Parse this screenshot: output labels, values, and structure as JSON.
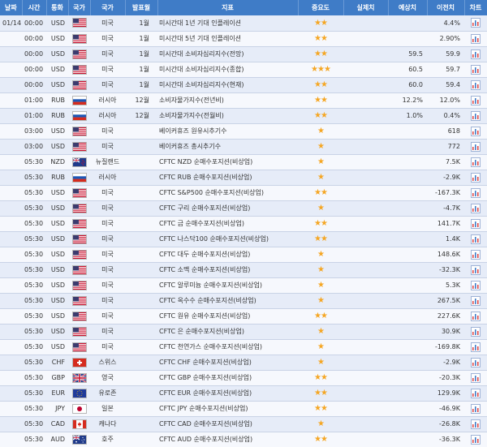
{
  "headers": [
    "날짜",
    "시간",
    "통화",
    "국가",
    "국가",
    "발표월",
    "지표",
    "중요도",
    "실제치",
    "예상치",
    "이전치",
    "차트"
  ],
  "rows": [
    {
      "date": "01/14",
      "time": "00:00",
      "cur": "USD",
      "flag": "us",
      "country": "미국",
      "period": "1월",
      "name": "미시간대 1년 기대 인플레이션",
      "stars": 2,
      "actual": "",
      "forecast": "",
      "previous": "4.4%"
    },
    {
      "date": "",
      "time": "00:00",
      "cur": "USD",
      "flag": "us",
      "country": "미국",
      "period": "1월",
      "name": "미시간대 5년 기대 인플레이션",
      "stars": 2,
      "actual": "",
      "forecast": "",
      "previous": "2.90%"
    },
    {
      "date": "",
      "time": "00:00",
      "cur": "USD",
      "flag": "us",
      "country": "미국",
      "period": "1월",
      "name": "미시간대 소비자심리지수(전망)",
      "stars": 2,
      "actual": "",
      "forecast": "59.5",
      "previous": "59.9"
    },
    {
      "date": "",
      "time": "00:00",
      "cur": "USD",
      "flag": "us",
      "country": "미국",
      "period": "1월",
      "name": "미시간대 소비자심리지수(종합)",
      "stars": 3,
      "actual": "",
      "forecast": "60.5",
      "previous": "59.7"
    },
    {
      "date": "",
      "time": "00:00",
      "cur": "USD",
      "flag": "us",
      "country": "미국",
      "period": "1월",
      "name": "미시간대 소비자심리지수(현재)",
      "stars": 2,
      "actual": "",
      "forecast": "60.0",
      "previous": "59.4"
    },
    {
      "date": "",
      "time": "01:00",
      "cur": "RUB",
      "flag": "ru",
      "country": "러시아",
      "period": "12월",
      "name": "소비자물가지수(전년비)",
      "stars": 2,
      "actual": "",
      "forecast": "12.2%",
      "previous": "12.0%"
    },
    {
      "date": "",
      "time": "01:00",
      "cur": "RUB",
      "flag": "ru",
      "country": "러시아",
      "period": "12월",
      "name": "소비자물가지수(전월비)",
      "stars": 2,
      "actual": "",
      "forecast": "1.0%",
      "previous": "0.4%"
    },
    {
      "date": "",
      "time": "03:00",
      "cur": "USD",
      "flag": "us",
      "country": "미국",
      "period": "",
      "name": "베이커휴즈 원유시추기수",
      "stars": 1,
      "actual": "",
      "forecast": "",
      "previous": "618"
    },
    {
      "date": "",
      "time": "03:00",
      "cur": "USD",
      "flag": "us",
      "country": "미국",
      "period": "",
      "name": "베이커휴즈 총시추기수",
      "stars": 1,
      "actual": "",
      "forecast": "",
      "previous": "772"
    },
    {
      "date": "",
      "time": "05:30",
      "cur": "NZD",
      "flag": "nz",
      "country": "뉴질랜드",
      "period": "",
      "name": "CFTC NZD 순매수포지션(비상업)",
      "stars": 1,
      "actual": "",
      "forecast": "",
      "previous": "7.5K"
    },
    {
      "date": "",
      "time": "05:30",
      "cur": "RUB",
      "flag": "ru",
      "country": "러시아",
      "period": "",
      "name": "CFTC RUB 순매수포지션(비상업)",
      "stars": 1,
      "actual": "",
      "forecast": "",
      "previous": "-2.9K"
    },
    {
      "date": "",
      "time": "05:30",
      "cur": "USD",
      "flag": "us",
      "country": "미국",
      "period": "",
      "name": "CFTC S&P500 순매수포지션(비상업)",
      "stars": 2,
      "actual": "",
      "forecast": "",
      "previous": "-167.3K"
    },
    {
      "date": "",
      "time": "05:30",
      "cur": "USD",
      "flag": "us",
      "country": "미국",
      "period": "",
      "name": "CFTC 구리 순매수포지션(비상업)",
      "stars": 1,
      "actual": "",
      "forecast": "",
      "previous": "-4.7K"
    },
    {
      "date": "",
      "time": "05:30",
      "cur": "USD",
      "flag": "us",
      "country": "미국",
      "period": "",
      "name": "CFTC 금 순매수포지션(비상업)",
      "stars": 2,
      "actual": "",
      "forecast": "",
      "previous": "141.7K"
    },
    {
      "date": "",
      "time": "05:30",
      "cur": "USD",
      "flag": "us",
      "country": "미국",
      "period": "",
      "name": "CFTC 나스닥100 순매수포지션(비상업)",
      "stars": 2,
      "actual": "",
      "forecast": "",
      "previous": "1.4K"
    },
    {
      "date": "",
      "time": "05:30",
      "cur": "USD",
      "flag": "us",
      "country": "미국",
      "period": "",
      "name": "CFTC 대두 순매수포지션(비상업)",
      "stars": 1,
      "actual": "",
      "forecast": "",
      "previous": "148.6K"
    },
    {
      "date": "",
      "time": "05:30",
      "cur": "USD",
      "flag": "us",
      "country": "미국",
      "period": "",
      "name": "CFTC 소맥 순매수포지션(비상업)",
      "stars": 1,
      "actual": "",
      "forecast": "",
      "previous": "-32.3K"
    },
    {
      "date": "",
      "time": "05:30",
      "cur": "USD",
      "flag": "us",
      "country": "미국",
      "period": "",
      "name": "CFTC 알루미늄 순매수포지션(비상업)",
      "stars": 1,
      "actual": "",
      "forecast": "",
      "previous": "5.3K"
    },
    {
      "date": "",
      "time": "05:30",
      "cur": "USD",
      "flag": "us",
      "country": "미국",
      "period": "",
      "name": "CFTC 옥수수 순매수포지션(비상업)",
      "stars": 1,
      "actual": "",
      "forecast": "",
      "previous": "267.5K"
    },
    {
      "date": "",
      "time": "05:30",
      "cur": "USD",
      "flag": "us",
      "country": "미국",
      "period": "",
      "name": "CFTC 원유 순매수포지션(비상업)",
      "stars": 2,
      "actual": "",
      "forecast": "",
      "previous": "227.6K"
    },
    {
      "date": "",
      "time": "05:30",
      "cur": "USD",
      "flag": "us",
      "country": "미국",
      "period": "",
      "name": "CFTC 은 순매수포지션(비상업)",
      "stars": 1,
      "actual": "",
      "forecast": "",
      "previous": "30.9K"
    },
    {
      "date": "",
      "time": "05:30",
      "cur": "USD",
      "flag": "us",
      "country": "미국",
      "period": "",
      "name": "CFTC 천연가스 순매수포지션(비상업)",
      "stars": 1,
      "actual": "",
      "forecast": "",
      "previous": "-169.8K"
    },
    {
      "date": "",
      "time": "05:30",
      "cur": "CHF",
      "flag": "ch",
      "country": "스위스",
      "period": "",
      "name": "CFTC CHF 순매수포지션(비상업)",
      "stars": 1,
      "actual": "",
      "forecast": "",
      "previous": "-2.9K"
    },
    {
      "date": "",
      "time": "05:30",
      "cur": "GBP",
      "flag": "gb",
      "country": "영국",
      "period": "",
      "name": "CFTC GBP 순매수포지션(비상업)",
      "stars": 2,
      "actual": "",
      "forecast": "",
      "previous": "-20.3K"
    },
    {
      "date": "",
      "time": "05:30",
      "cur": "EUR",
      "flag": "eu",
      "country": "유로존",
      "period": "",
      "name": "CFTC EUR 순매수포지션(비상업)",
      "stars": 2,
      "actual": "",
      "forecast": "",
      "previous": "129.9K"
    },
    {
      "date": "",
      "time": "05:30",
      "cur": "JPY",
      "flag": "jp",
      "country": "일본",
      "period": "",
      "name": "CFTC JPY 순매수포지션(비상업)",
      "stars": 2,
      "actual": "",
      "forecast": "",
      "previous": "-46.9K"
    },
    {
      "date": "",
      "time": "05:30",
      "cur": "CAD",
      "flag": "ca",
      "country": "캐나다",
      "period": "",
      "name": "CFTC CAD 순매수포지션(비상업)",
      "stars": 1,
      "actual": "",
      "forecast": "",
      "previous": "-26.8K"
    },
    {
      "date": "",
      "time": "05:30",
      "cur": "AUD",
      "flag": "au",
      "country": "호주",
      "period": "",
      "name": "CFTC AUD 순매수포지션(비상업)",
      "stars": 2,
      "actual": "",
      "forecast": "",
      "previous": "-36.3K"
    }
  ],
  "colors": {
    "header_bg": "#3f7cc7",
    "star": "#f5a623",
    "row_odd": "#e6ecf8",
    "row_even": "#f6f8fd"
  }
}
